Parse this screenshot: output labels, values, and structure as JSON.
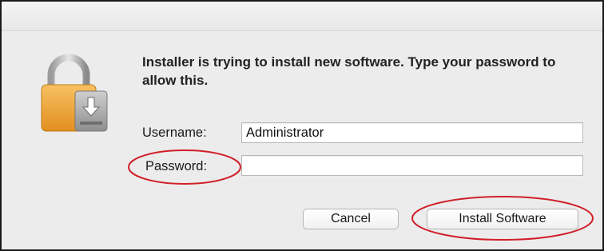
{
  "dialog": {
    "message": "Installer is trying to install new software. Type your password to allow this."
  },
  "form": {
    "username_label": "Username:",
    "username_value": "Administrator",
    "password_label": "Password:",
    "password_value": ""
  },
  "buttons": {
    "cancel_label": "Cancel",
    "install_label": "Install Software"
  },
  "icon": "lock-installer-icon",
  "colors": {
    "lock_body": "#f1a93a",
    "annotation": "#d0202a"
  }
}
